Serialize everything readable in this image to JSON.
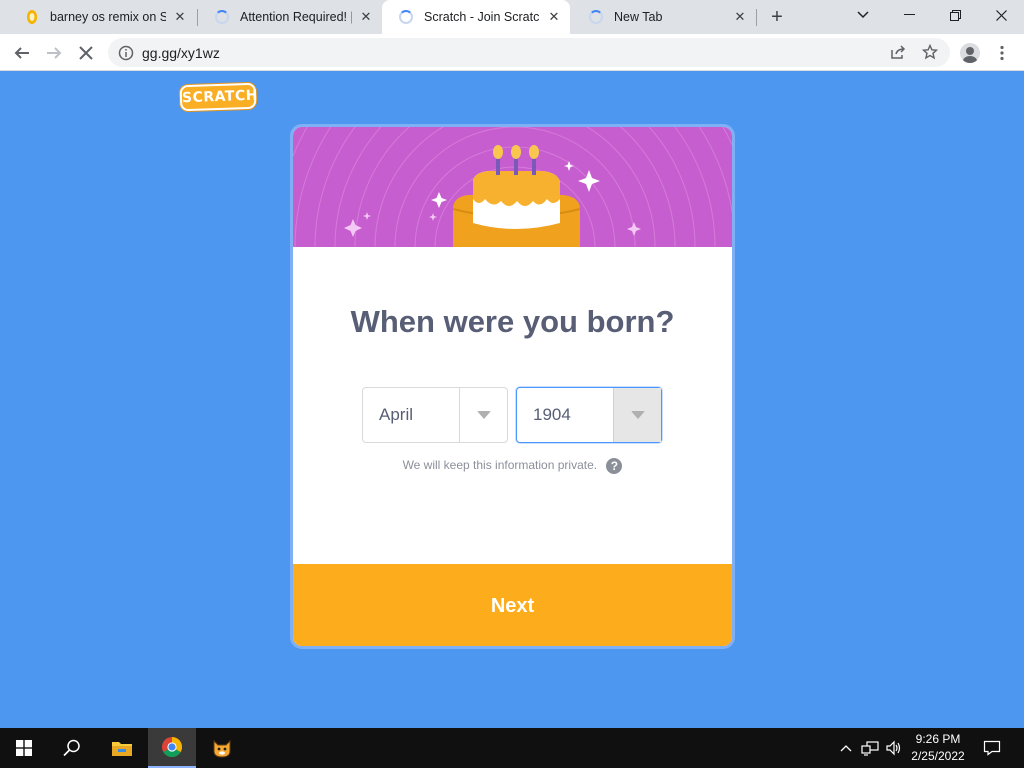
{
  "browser": {
    "tabs": [
      {
        "title": "barney os remix on Scr",
        "favicon": "scratch-favicon"
      },
      {
        "title": "Attention Required! | C",
        "favicon": "loading-spinner-icon"
      },
      {
        "title": "Scratch - Join Scratch",
        "favicon": "loading-spinner-icon"
      },
      {
        "title": "New Tab",
        "favicon": "loading-spinner-icon"
      }
    ],
    "active_tab": 2,
    "url": "gg.gg/xy1wz"
  },
  "page": {
    "logo_text": "SCRATCH",
    "heading": "When were you born?",
    "month": "April",
    "year": "1904",
    "privacy_note": "We will keep this information private.",
    "help_glyph": "?",
    "next_label": "Next"
  },
  "taskbar": {
    "time": "9:26 PM",
    "date": "2/25/2022"
  },
  "colors": {
    "page_background": "#4d97f0",
    "banner": "#c75ecf",
    "next_button": "#fdac1c",
    "heading_text": "#575e75"
  }
}
